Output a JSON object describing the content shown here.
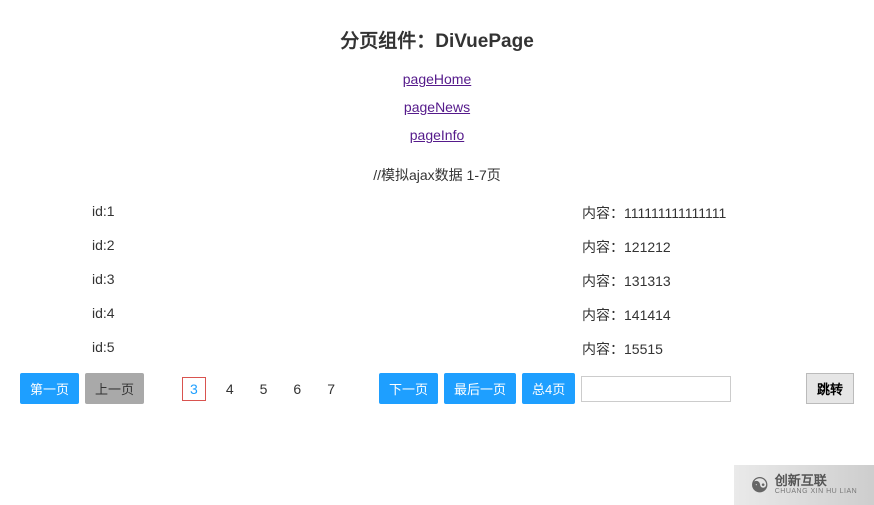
{
  "title": "分页组件：DiVuePage",
  "links": [
    {
      "label": "pageHome"
    },
    {
      "label": "pageNews"
    },
    {
      "label": "pageInfo"
    }
  ],
  "ajax_label": "//模拟ajax数据 1-7页",
  "rows": [
    {
      "id": "id:1",
      "content": "内容：111111111111111"
    },
    {
      "id": "id:2",
      "content": "内容：121212"
    },
    {
      "id": "id:3",
      "content": "内容：131313"
    },
    {
      "id": "id:4",
      "content": "内容：141414"
    },
    {
      "id": "id:5",
      "content": "内容：15515"
    }
  ],
  "pagination": {
    "first": "第一页",
    "prev": "上一页",
    "pages": [
      "3",
      "4",
      "5",
      "6",
      "7"
    ],
    "current_index": 0,
    "next": "下一页",
    "last": "最后一页",
    "total_label": "总4页",
    "jump_btn": "跳转",
    "jump_placeholder": ""
  },
  "watermark": {
    "cn": "创新互联",
    "en": "CHUANG XIN HU LIAN"
  }
}
